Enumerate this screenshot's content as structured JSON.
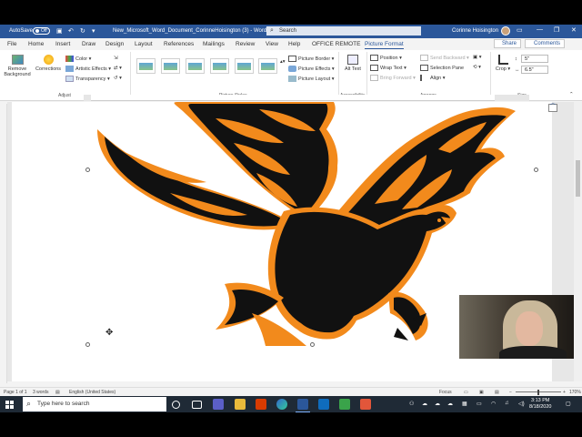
{
  "titlebar": {
    "autosave_label": "AutoSave",
    "autosave_state": "Off",
    "document_title": "New_Microsoft_Word_Document_CorinneHoisington (3) - Word",
    "search_text": "Search",
    "user_name": "Corinne Hoisington"
  },
  "tabs": [
    "File",
    "Home",
    "Insert",
    "Draw",
    "Design",
    "Layout",
    "References",
    "Mailings",
    "Review",
    "View",
    "Help",
    "OFFICE REMOTE",
    "Picture Format"
  ],
  "active_tab": "Picture Format",
  "share_label": "Share",
  "comments_label": "Comments",
  "ribbon": {
    "remove_background": "Remove Background",
    "corrections": "Corrections",
    "color": "Color",
    "artistic_effects": "Artistic Effects",
    "transparency": "Transparency",
    "adjust_group": "Adjust",
    "picture_styles_group": "Picture Styles",
    "picture_border": "Picture Border",
    "picture_effects": "Picture Effects",
    "picture_layout": "Picture Layout",
    "alt_text": "Alt Text",
    "accessibility_group": "Accessibility",
    "position": "Position",
    "wrap_text": "Wrap Text",
    "bring_forward": "Bring Forward",
    "send_backward": "Send Backward",
    "selection_pane": "Selection Pane",
    "align": "Align",
    "arrange_group": "Arrange",
    "crop": "Crop",
    "height_value": "5\"",
    "width_value": "6.5\"",
    "size_group": "Size"
  },
  "statusbar": {
    "page": "Page 1 of 1",
    "words": "3 words",
    "language": "English (United States)",
    "focus": "Focus",
    "zoom": "170%"
  },
  "taskbar": {
    "search_placeholder": "Type here to search",
    "time": "3:13 PM",
    "date": "8/18/2020"
  },
  "colors": {
    "word_blue": "#2b579a",
    "eagle_orange": "#f28a1c",
    "eagle_black": "#111111"
  },
  "icons": [
    "search-icon",
    "save-icon",
    "undo-icon",
    "redo-icon",
    "minimize-icon",
    "maximize-icon",
    "close-icon",
    "windows-start-icon",
    "mic-icon"
  ]
}
